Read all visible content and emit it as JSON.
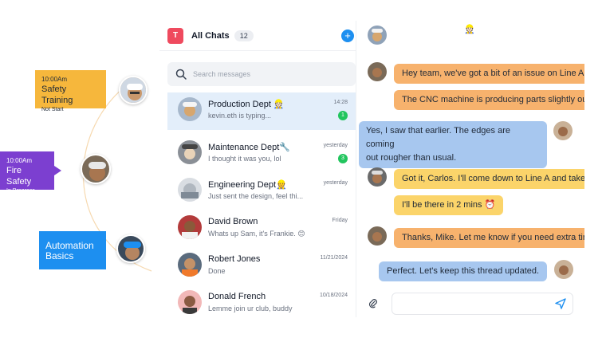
{
  "timeline": {
    "items": [
      {
        "time": "10:00Am",
        "title": "Safety Training",
        "status": "Not Start"
      },
      {
        "time": "10:00Am",
        "title": "Fire Safety",
        "status": "In Progress"
      },
      {
        "title_line1": "Automation",
        "title_line2": "Basics"
      }
    ]
  },
  "sidebar": {
    "app_initial": "T",
    "title": "All Chats",
    "count": "12",
    "search_placeholder": "Search messages",
    "chats": [
      {
        "name": "Production Dept 👷🏻",
        "preview": "kevin.eth is typing...",
        "time": "14:28",
        "unread": "1"
      },
      {
        "name": "Maintenance Dept🔧",
        "preview": "I thought it was you, lol",
        "time": "yesterday",
        "unread": "3"
      },
      {
        "name": "Engineering Dept👷",
        "preview": "Just sent the design, feel thi...",
        "time": "yesterday"
      },
      {
        "name": "David Brown",
        "preview": "Whats up Sam, it's Frankie. 😊",
        "time": "Friday"
      },
      {
        "name": "Robert Jones",
        "preview": "Done",
        "time": "11/21/2024"
      },
      {
        "name": "Donald French",
        "preview": "Lemme join ur club, buddy",
        "time": "10/18/2024"
      }
    ]
  },
  "conversation": {
    "header_emoji": "👷🏻",
    "messages": [
      {
        "text": "Hey team, we've got a bit of an issue on Line A"
      },
      {
        "text": "The CNC machine is producing parts slightly ou"
      },
      {
        "text_line1": "Yes, I saw that earlier. The edges are coming",
        "text_line2": "out rougher than usual."
      },
      {
        "text": "Got it, Carlos. I'll come down to Line A and take"
      },
      {
        "text": "I'll be there in 2 mins ⏰"
      },
      {
        "text": "Thanks, Mike. Let me know if you need extra tin"
      },
      {
        "text": "Perfect. Let's keep this thread updated."
      }
    ]
  },
  "colors": {
    "orange_card": "#f6b73c",
    "purple_card": "#7c3fd0",
    "blue_card": "#1d8ff0",
    "brand": "#ef4a5e",
    "active_row": "#e3eefa",
    "unread": "#22c55e"
  }
}
